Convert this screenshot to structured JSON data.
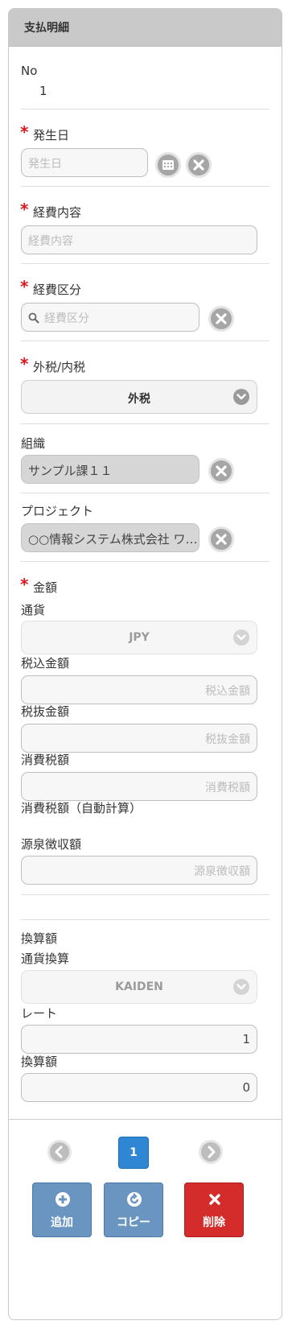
{
  "header": {
    "title": "支払明細"
  },
  "no": {
    "label": "No",
    "value": "1"
  },
  "occur_date": {
    "label": "発生日",
    "placeholder": "発生日",
    "calendar_icon": "calendar-icon",
    "clear_icon": "clear-icon"
  },
  "expense_detail": {
    "label": "経費内容",
    "placeholder": "経費内容"
  },
  "expense_category": {
    "label": "経費区分",
    "placeholder": "経費区分",
    "search_icon": "search-icon"
  },
  "tax_type": {
    "label": "外税/内税",
    "selected": "外税"
  },
  "organization": {
    "label": "組織",
    "value": "サンプル課１１"
  },
  "project": {
    "label": "プロジェクト",
    "value": "○○情報システム株式会社 ワ…"
  },
  "amount": {
    "label": "金額",
    "currency_label": "通貨",
    "currency_selected": "JPY",
    "tax_included_label": "税込金額",
    "tax_included_placeholder": "税込金額",
    "tax_excluded_label": "税抜金額",
    "tax_excluded_placeholder": "税抜金額",
    "consumption_tax_label": "消費税額",
    "consumption_tax_placeholder": "消費税額",
    "auto_calc_label": "消費税額（自動計算）",
    "withholding_label": "源泉徴収額",
    "withholding_placeholder": "源泉徴収額"
  },
  "converted": {
    "section_label": "換算額",
    "conversion_label": "通貨換算",
    "conversion_selected": "KAIDEN",
    "rate_label": "レート",
    "rate_value": "1",
    "amount_label": "換算額",
    "amount_value": "0"
  },
  "pager": {
    "current_page": "1"
  },
  "actions": {
    "add_label": "追加",
    "copy_label": "コピー",
    "delete_label": "削除"
  },
  "colors": {
    "required": "#e0141a",
    "page_active": "#2f86d3",
    "delete": "#d42b2b",
    "action_blue": "#6a95c0"
  }
}
